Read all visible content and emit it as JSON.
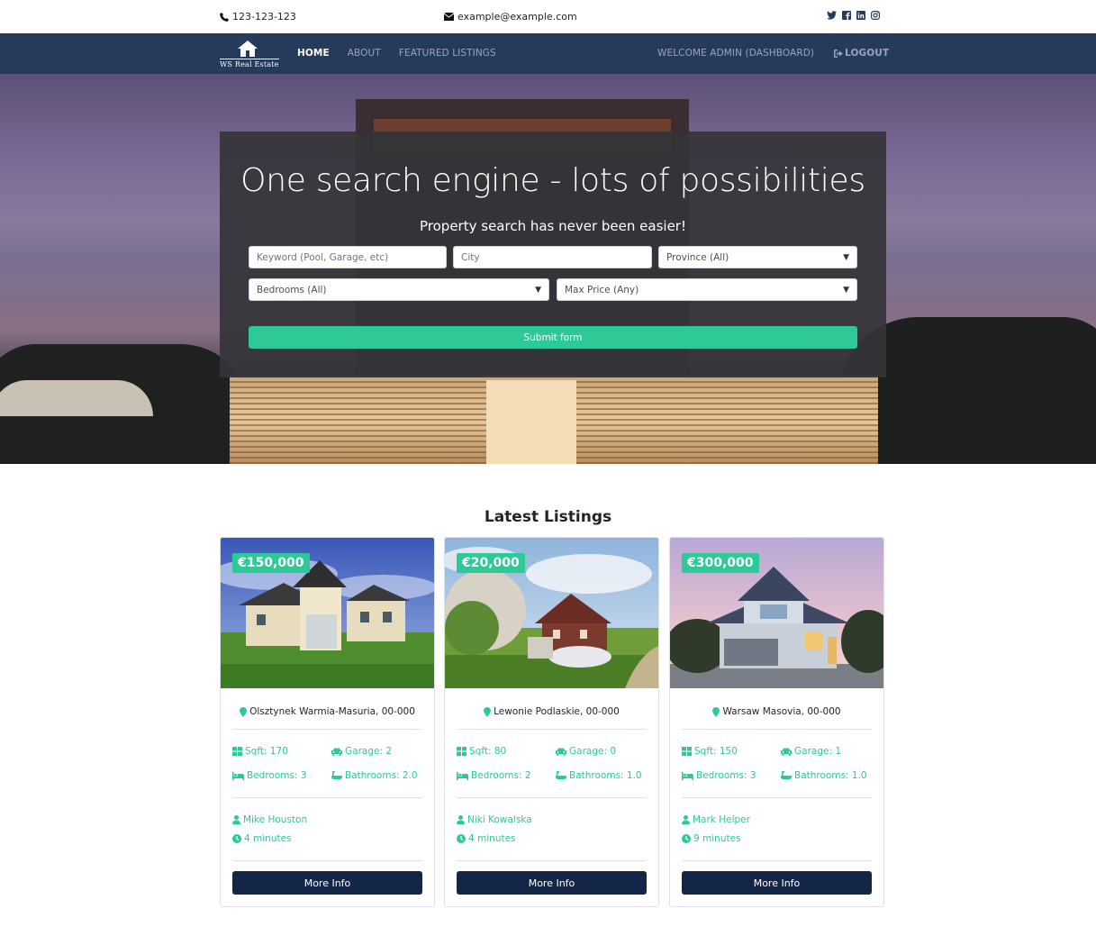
{
  "topbar": {
    "phone": "123-123-123",
    "email": "example@example.com",
    "social": [
      "twitter-icon",
      "facebook-icon",
      "linkedin-icon",
      "instagram-icon"
    ]
  },
  "navbar": {
    "logo_text": "WS Real Estate",
    "links": [
      {
        "label": "Home",
        "active": true
      },
      {
        "label": "About",
        "active": false
      },
      {
        "label": "Featured Listings",
        "active": false
      }
    ],
    "welcome": "Welcome Admin (Dashboard)",
    "logout": "Logout"
  },
  "hero": {
    "title": "One search engine - lots of possibilities",
    "subtitle": "Property search has never been easier!",
    "keyword_placeholder": "Keyword (Pool, Garage, etc)",
    "city_placeholder": "City",
    "province_selected": "Province (All)",
    "bedrooms_selected": "Bedrooms (All)",
    "max_price_selected": "Max Price (Any)",
    "submit_label": "Submit form"
  },
  "listings": {
    "title": "Latest Listings",
    "more_info_label": "More Info",
    "items": [
      {
        "price": "€150,000",
        "location": "Olsztynek Warmia-Masuria, 00-000",
        "sqft": "Sqft: 170",
        "garage": "Garage: 2",
        "bedrooms": "Bedrooms: 3",
        "bathrooms": "Bathrooms: 2.0",
        "agent": "Mike Houston",
        "time": "4 minutes"
      },
      {
        "price": "€20,000",
        "location": "Lewonie Podlaskie, 00-000",
        "sqft": "Sqft: 80",
        "garage": "Garage: 0",
        "bedrooms": "Bedrooms: 2",
        "bathrooms": "Bathrooms: 1.0",
        "agent": "Niki Kowalska",
        "time": "4 minutes"
      },
      {
        "price": "€300,000",
        "location": "Warsaw Masovia, 00-000",
        "sqft": "Sqft: 150",
        "garage": "Garage: 1",
        "bedrooms": "Bedrooms: 3",
        "bathrooms": "Bathrooms: 1.0",
        "agent": "Mark Helper",
        "time": "9 minutes"
      }
    ]
  },
  "colors": {
    "accent": "#2dc997",
    "navbar": "#263a5c",
    "button_dark": "#132647"
  }
}
